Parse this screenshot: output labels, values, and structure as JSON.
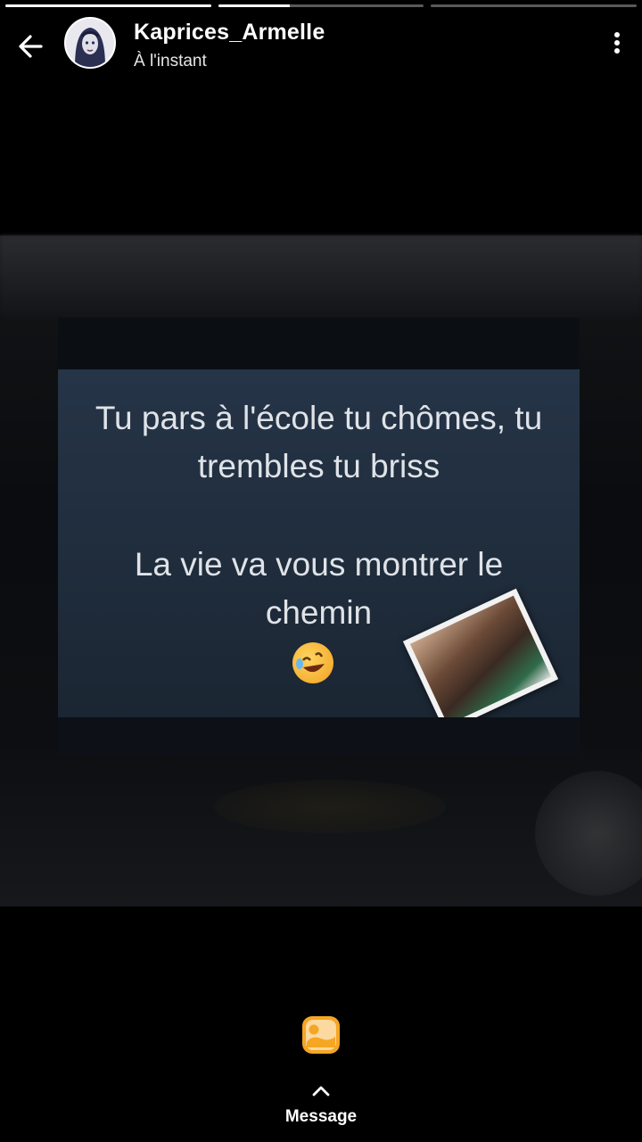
{
  "progress": [
    {
      "fill_fraction": 1.0
    },
    {
      "fill_fraction": 0.35
    },
    {
      "fill_fraction": 0.0
    }
  ],
  "header": {
    "username": "Kaprices_Armelle",
    "time": "À l'instant",
    "back_icon": "arrow-left-icon",
    "more_icon": "more-vertical-icon"
  },
  "story": {
    "line1": "Tu pars à l'école tu chômes, tu trembles tu briss",
    "line2": "La vie va vous montrer le chemin",
    "emoji_icon": "rolling-on-floor-laughing-emoji"
  },
  "footer": {
    "reply_icon": "sticker-reply-icon",
    "chevron_icon": "chevron-up-icon",
    "message_label": "Message"
  },
  "colors": {
    "background": "#000000",
    "panel": "#253447",
    "accent": "#f5a623"
  }
}
